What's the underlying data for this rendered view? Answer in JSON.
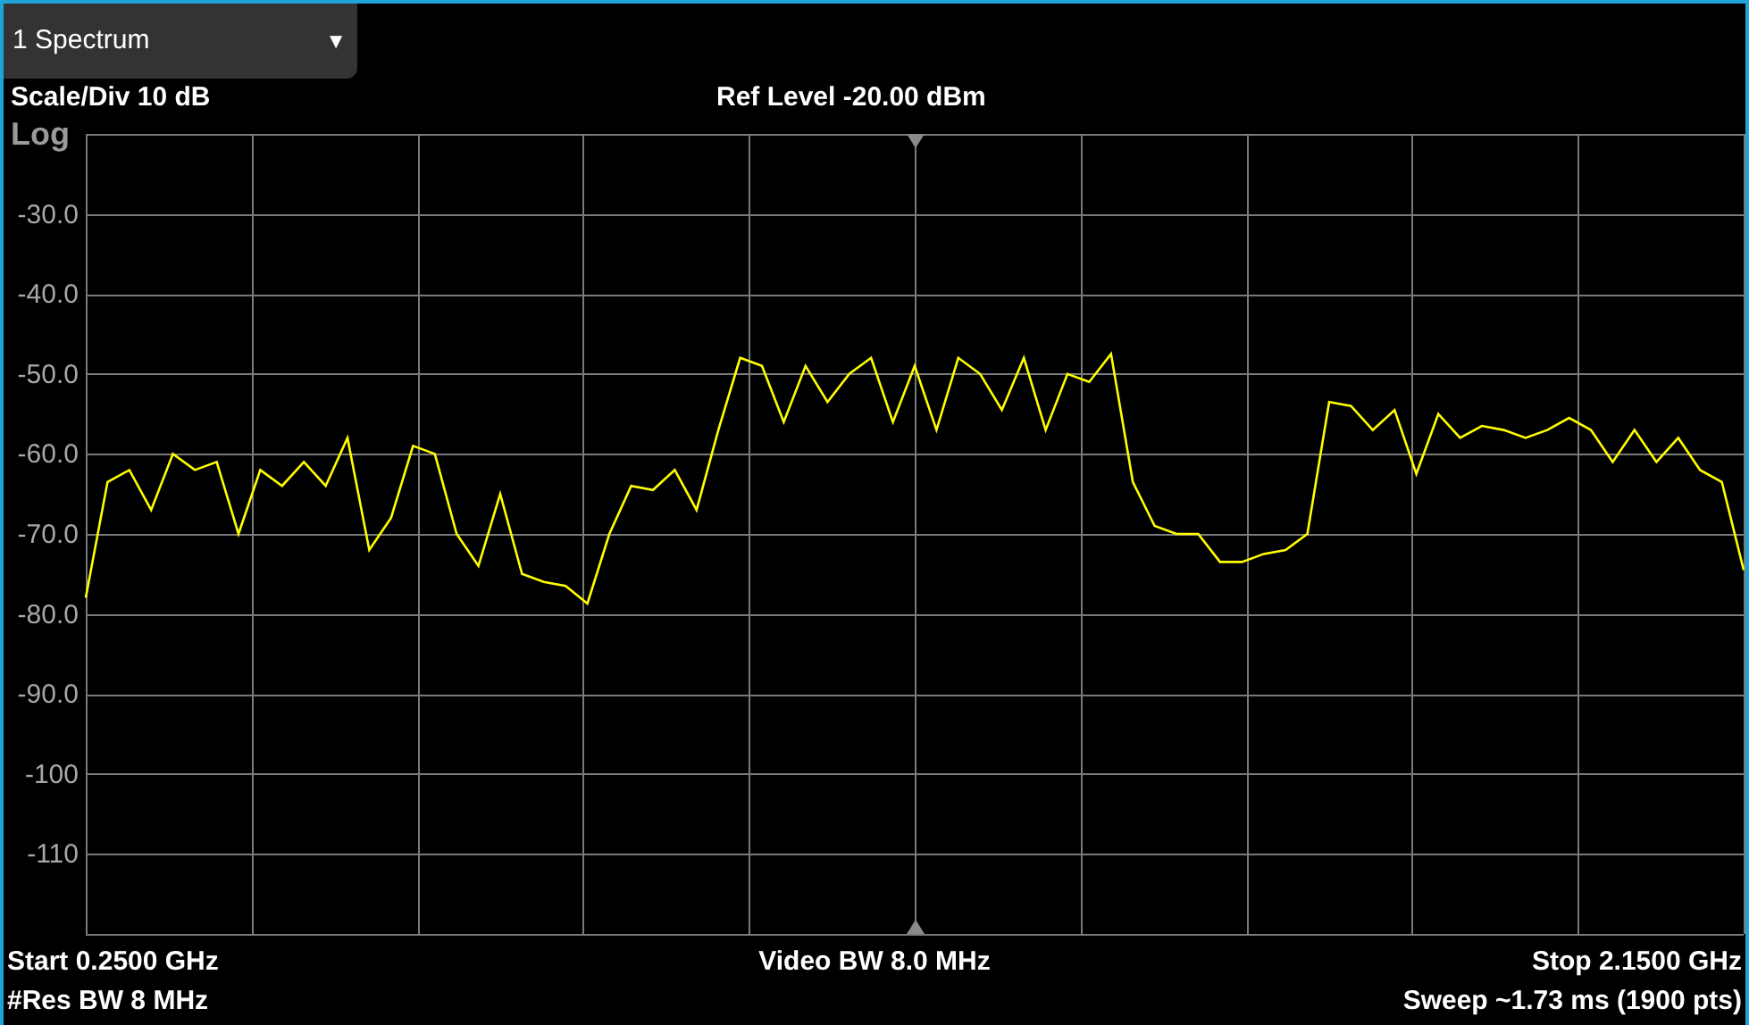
{
  "trace_selector": {
    "label": "1 Spectrum",
    "caret": "▼"
  },
  "header": {
    "scale": "Scale/Div 10 dB",
    "ref_level": "Ref Level -20.00 dBm"
  },
  "plot": {
    "scale_type": "Log",
    "chart_data": {
      "type": "line",
      "grid": true,
      "ylim": [
        -120,
        -20
      ],
      "yticks": [
        {
          "value": -30,
          "label": "-30.0"
        },
        {
          "value": -40,
          "label": "-40.0"
        },
        {
          "value": -50,
          "label": "-50.0"
        },
        {
          "value": -60,
          "label": "-60.0"
        },
        {
          "value": -70,
          "label": "-70.0"
        },
        {
          "value": -80,
          "label": "-80.0"
        },
        {
          "value": -90,
          "label": "-90.0"
        },
        {
          "value": -100,
          "label": "-100"
        },
        {
          "value": -110,
          "label": "-110"
        }
      ],
      "categories": [
        null,
        null,
        null,
        null,
        null,
        null,
        null,
        null,
        null,
        null,
        null,
        null,
        null,
        null,
        null,
        null,
        null,
        null,
        null,
        null,
        null,
        null,
        null,
        null,
        null,
        null,
        null,
        null,
        null,
        null,
        null,
        null,
        null,
        null,
        null,
        null,
        null,
        null,
        null,
        null,
        null,
        null,
        null,
        null,
        null,
        null,
        null,
        null,
        null,
        null,
        null,
        null,
        null,
        null,
        null,
        null,
        null,
        null,
        null,
        null,
        null,
        null,
        null,
        null,
        null,
        null,
        null,
        null,
        null,
        null,
        null,
        null,
        null,
        null,
        null,
        null,
        null
      ],
      "series": [
        {
          "color": "#ffff00",
          "values": [
            -78,
            -63.5,
            -62,
            -67,
            -60,
            -62,
            -61,
            -70,
            -62,
            -64,
            -61,
            -64,
            -58,
            -72,
            -68,
            -59,
            -60,
            -70,
            -74,
            -65,
            -75,
            -76,
            -76.5,
            -78.7,
            -70,
            -64,
            -64.5,
            -62,
            -67,
            -57,
            -48,
            -49,
            -56,
            -49,
            -53.5,
            -50,
            -48,
            -56,
            -49,
            -57,
            -48,
            -50,
            -54.5,
            -48,
            -57,
            -50,
            -51,
            -47.5,
            -63.5,
            -69,
            -70,
            -70,
            -73.5,
            -73.5,
            -72.5,
            -72,
            -70,
            -53.5,
            -54,
            -57,
            -54.5,
            -62.5,
            -55,
            -58,
            -56.5,
            -57,
            -58,
            -57,
            -55.5,
            -57,
            -61,
            -57,
            -61,
            -58,
            -62,
            -63.5,
            -74.5
          ]
        }
      ]
    }
  },
  "footer": {
    "start": "Start 0.2500 GHz",
    "video_bw": "Video BW 8.0 MHz",
    "stop": "Stop 2.1500 GHz",
    "res_bw": "#Res BW 8 MHz",
    "sweep": "Sweep ~1.73 ms (1900 pts)"
  }
}
